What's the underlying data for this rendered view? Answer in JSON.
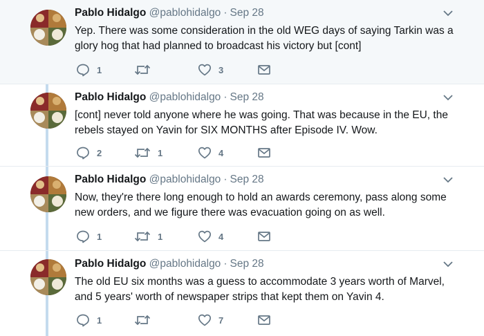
{
  "tweets": [
    {
      "name": "Pablo Hidalgo",
      "handle": "@pablohidalgo",
      "separator": "·",
      "date": "Sep 28",
      "text": "Yep. There was some consideration in the old WEG days of saying Tarkin was a glory hog that had planned to broadcast his victory but [cont]",
      "reply_count": "1",
      "retweet_count": "",
      "like_count": "3"
    },
    {
      "name": "Pablo Hidalgo",
      "handle": "@pablohidalgo",
      "separator": "·",
      "date": "Sep 28",
      "text": "[cont] never told anyone where he was going. That was because in the EU, the rebels stayed on Yavin for SIX MONTHS after Episode IV. Wow.",
      "reply_count": "2",
      "retweet_count": "1",
      "like_count": "4"
    },
    {
      "name": "Pablo Hidalgo",
      "handle": "@pablohidalgo",
      "separator": "·",
      "date": "Sep 28",
      "text": "Now, they're there long enough to hold an awards ceremony, pass along some new orders, and we figure there was evacuation going on as well.",
      "reply_count": "1",
      "retweet_count": "1",
      "like_count": "4"
    },
    {
      "name": "Pablo Hidalgo",
      "handle": "@pablohidalgo",
      "separator": "·",
      "date": "Sep 28",
      "text": "The old EU six months was a guess to accommodate 3 years worth of Marvel, and 5 years' worth of newspaper strips that kept them on Yavin 4.",
      "reply_count": "1",
      "retweet_count": "",
      "like_count": "7"
    }
  ],
  "colors": {
    "thread_line": "#c4dbee",
    "meta": "#657786",
    "highlight_bg": "#f5f8fa"
  },
  "icons": {
    "reply": "reply-icon",
    "retweet": "retweet-icon",
    "like": "heart-icon",
    "dm": "envelope-icon",
    "menu": "chevron-down-icon"
  }
}
